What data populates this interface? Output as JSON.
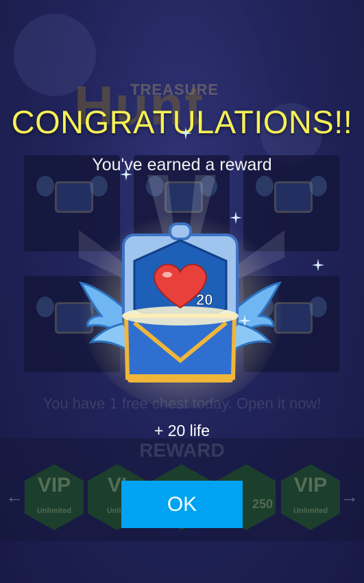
{
  "background": {
    "logo_small": "TREASURE",
    "logo_big": "Hunt",
    "free_chest_text": "You have 1 free chest today. Open it now!",
    "reward_heading": "REWARD",
    "reward_items": [
      {
        "value": "VIP",
        "label": "Unlimited"
      },
      {
        "value": "VI",
        "label": "Unlim"
      },
      {
        "value": "",
        "label": ""
      },
      {
        "value": "",
        "label": "250"
      },
      {
        "value": "VIP",
        "label": "Unlimited"
      }
    ],
    "prev_arrow": "←",
    "next_arrow": "→"
  },
  "dialog": {
    "title": "CONGRATULATIONS!!",
    "subtitle": "You've earned a reward",
    "reward_amount": "20",
    "reward_text": "+ 20 life",
    "ok_label": "OK"
  },
  "colors": {
    "title": "#f6f157",
    "ok_button": "#00a3f2",
    "heart": "#e8413b",
    "chest_blue": "#2f6fd0",
    "chest_gold": "#f0b63a"
  },
  "icons": [
    "heart-icon",
    "winged-chest-icon",
    "sparkle-icon"
  ]
}
